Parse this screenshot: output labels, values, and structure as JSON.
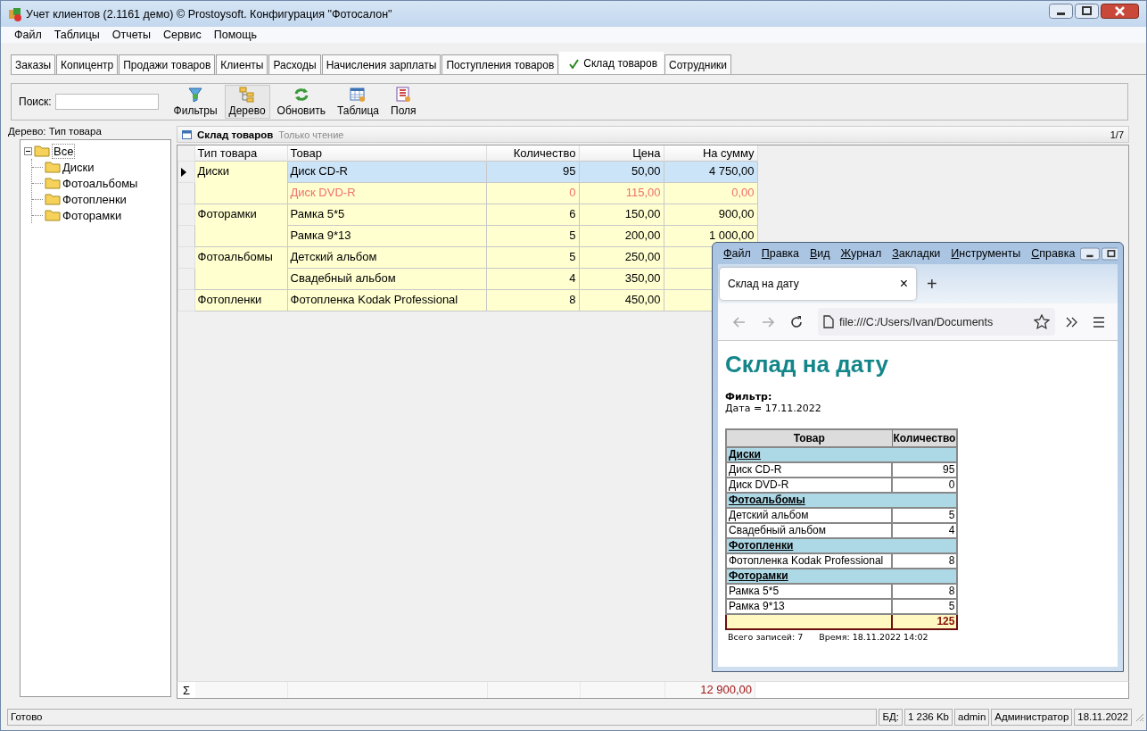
{
  "window": {
    "title": "Учет клиентов (2.1161 демо) © Prostoysoft. Конфигурация \"Фотосалон\""
  },
  "menu": [
    "Файл",
    "Таблицы",
    "Отчеты",
    "Сервис",
    "Помощь"
  ],
  "tabs": [
    {
      "label": "Заказы",
      "selected": false
    },
    {
      "label": "Копицентр",
      "selected": false
    },
    {
      "label": "Продажи товаров",
      "selected": false
    },
    {
      "label": "Клиенты",
      "selected": false
    },
    {
      "label": "Расходы",
      "selected": false
    },
    {
      "label": "Начисления зарплаты",
      "selected": false
    },
    {
      "label": "Поступления товаров",
      "selected": false
    },
    {
      "label": "Склад товаров",
      "selected": true
    },
    {
      "label": "Сотрудники",
      "selected": false
    }
  ],
  "toolbar": {
    "search_label": "Поиск:",
    "buttons": [
      {
        "label": "Фильтры",
        "kind": "filter",
        "pressed": false
      },
      {
        "label": "Дерево",
        "kind": "tree",
        "pressed": true
      },
      {
        "label": "Обновить",
        "kind": "refresh",
        "pressed": false
      },
      {
        "label": "Таблица",
        "kind": "table",
        "pressed": false
      },
      {
        "label": "Поля",
        "kind": "fields",
        "pressed": false
      }
    ]
  },
  "tree": {
    "title": "Дерево: Тип товара",
    "root": {
      "label": "Все",
      "expanded": true,
      "children": [
        {
          "label": "Диски"
        },
        {
          "label": "Фотоальбомы"
        },
        {
          "label": "Фотопленки"
        },
        {
          "label": "Фоторамки"
        }
      ]
    }
  },
  "grid": {
    "title": "Склад товаров",
    "mode": "Только чтение",
    "position": "1/7",
    "columns": [
      "Тип товара",
      "Товар",
      "Количество",
      "Цена",
      "На сумму"
    ],
    "groups": [
      {
        "type": "Диски",
        "rows": [
          {
            "name": "Диск CD-R",
            "qty": "95",
            "price": "50,00",
            "sum": "4 750,00",
            "selected": true,
            "out_of_stock": false
          },
          {
            "name": "Диск DVD-R",
            "qty": "0",
            "price": "115,00",
            "sum": "0,00",
            "selected": false,
            "out_of_stock": true
          }
        ]
      },
      {
        "type": "Фоторамки",
        "rows": [
          {
            "name": "Рамка 5*5",
            "qty": "6",
            "price": "150,00",
            "sum": "900,00",
            "selected": false,
            "out_of_stock": false
          },
          {
            "name": "Рамка 9*13",
            "qty": "5",
            "price": "200,00",
            "sum": "1 000,00",
            "selected": false,
            "out_of_stock": false
          }
        ]
      },
      {
        "type": "Фотоальбомы",
        "rows": [
          {
            "name": "Детский альбом",
            "qty": "5",
            "price": "250,00",
            "selected": false,
            "out_of_stock": false
          },
          {
            "name": "Свадебный альбом",
            "qty": "4",
            "price": "350,00",
            "selected": false,
            "out_of_stock": false
          }
        ]
      },
      {
        "type": "Фотопленки",
        "rows": [
          {
            "name": "Фотопленка Kodak Professional",
            "qty": "8",
            "price": "450,00",
            "selected": false,
            "out_of_stock": false
          }
        ]
      }
    ],
    "total_symbol": "Σ",
    "total": "12 900,00"
  },
  "status_bar": {
    "message": "Готово",
    "panels": [
      "БД:",
      "1 236 Kb",
      "admin",
      "Администратор",
      "18.11.2022"
    ]
  },
  "browser": {
    "menu": [
      "Файл",
      "Правка",
      "Вид",
      "Журнал",
      "Закладки",
      "Инструменты",
      "Справка"
    ],
    "tab": "Склад на дату",
    "tab_close": "×",
    "new_tab": "+",
    "address": "file:///C:/Users/Ivan/Documents",
    "page": {
      "heading": "Склад на дату",
      "filter_label": "Фильтр:",
      "filter": "Дата = 17.11.2022",
      "columns": [
        "Товар",
        "Количество"
      ],
      "groups": [
        {
          "name": "Диски",
          "rows": [
            [
              "Диск CD-R",
              "95"
            ],
            [
              "Диск DVD-R",
              "0"
            ]
          ]
        },
        {
          "name": "Фотоальбомы",
          "rows": [
            [
              "Детский альбом",
              "5"
            ],
            [
              "Свадебный альбом",
              "4"
            ]
          ]
        },
        {
          "name": "Фотопленки",
          "rows": [
            [
              "Фотопленка Kodak Professional",
              "8"
            ]
          ]
        },
        {
          "name": "Фоторамки",
          "rows": [
            [
              "Рамка 5*5",
              "8"
            ],
            [
              "Рамка 9*13",
              "5"
            ]
          ]
        }
      ],
      "total": "125",
      "records": "Всего записей: 7",
      "time": "Время: 18.11.2022 14:02"
    }
  }
}
